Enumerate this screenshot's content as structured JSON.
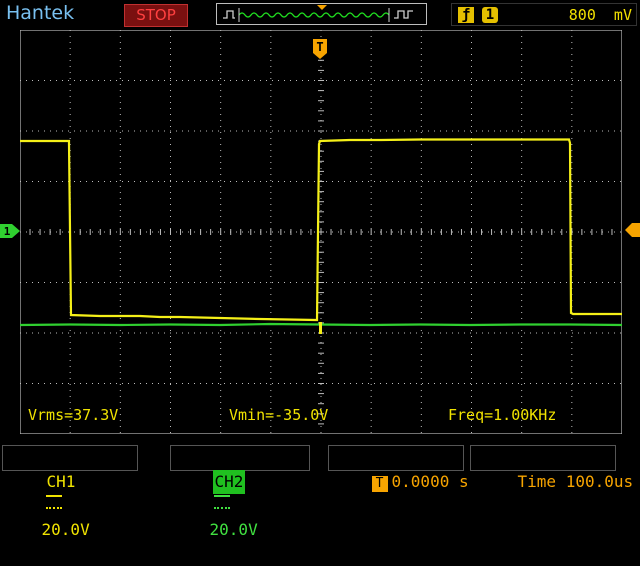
{
  "header": {
    "brand": "Hantek",
    "run_state": "STOP",
    "trigger": {
      "edge_icon": "rising-edge-icon",
      "source": "1",
      "level": "800  mV"
    }
  },
  "markers": {
    "trigger_position": "T",
    "ch1_ground": "1"
  },
  "measurements": {
    "vrms": "Vrms=37.3V",
    "vmin": "Vmin=-35.0V",
    "freq": "Freq=1.00KHz"
  },
  "channels": {
    "ch1": {
      "label": "CH1",
      "coupling_icon": "dc-coupling-icon",
      "scale": "20.0V"
    },
    "ch2": {
      "label": "CH2",
      "coupling_icon": "dc-coupling-icon",
      "scale": "20.0V"
    }
  },
  "horizontal": {
    "position_icon": "T",
    "position": "0.0000 s",
    "timebase": "Time 100.0us"
  },
  "colors": {
    "ch1": "#f5f018",
    "ch2": "#30d030",
    "accent": "#f7a400",
    "brand": "#79c0f0",
    "stop": "#ff4040"
  }
}
